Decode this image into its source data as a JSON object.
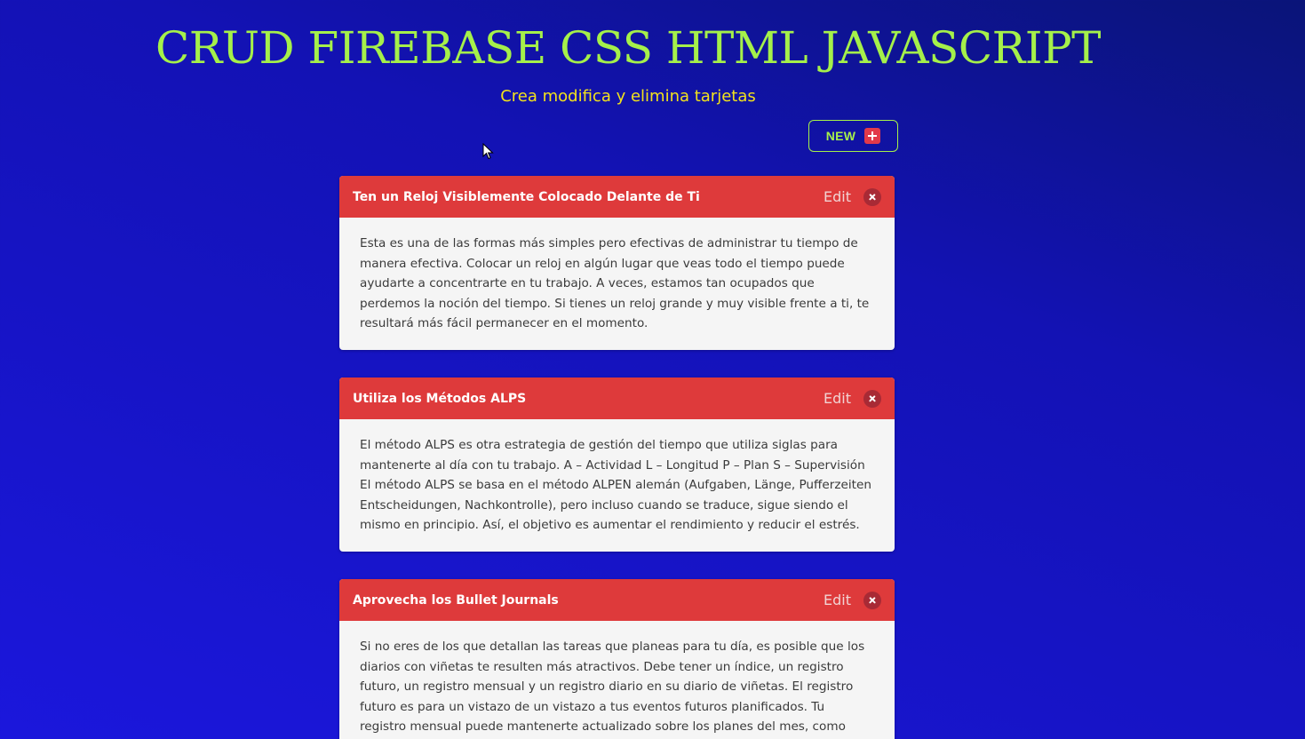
{
  "header": {
    "title": "CRUD FIREBASE CSS HTML JAVASCRIPT",
    "subtitle": "Crea modifica y elimina tarjetas"
  },
  "toolbar": {
    "new_label": "NEW",
    "new_icon": "plus-icon"
  },
  "colors": {
    "background": "#1a16d2",
    "title": "#a5f04a",
    "subtitle": "#f2e21c",
    "card_header": "#de3a3b",
    "card_body": "#f5f5f5"
  },
  "cards": [
    {
      "title": "Ten un Reloj Visiblemente Colocado Delante de Ti",
      "edit_label": "Edit",
      "body": "Esta es una de las formas más simples pero efectivas de administrar tu tiempo de manera efectiva. Colocar un reloj en algún lugar que veas todo el tiempo puede ayudarte a concentrarte en tu trabajo. A veces, estamos tan ocupados que perdemos la noción del tiempo. Si tienes un reloj grande y muy visible frente a ti, te resultará más fácil permanecer en el momento."
    },
    {
      "title": "Utiliza los Métodos ALPS",
      "edit_label": "Edit",
      "body": "El método ALPS es otra estrategia de gestión del tiempo que utiliza siglas para mantenerte al día con tu trabajo. A – Actividad L – Longitud P – Plan S – Supervisión El método ALPS se basa en el método ALPEN alemán (Aufgaben, Länge, Pufferzeiten Entscheidungen, Nachkontrolle), pero incluso cuando se traduce, sigue siendo el mismo en principio. Así, el objetivo es aumentar el rendimiento y reducir el estrés."
    },
    {
      "title": "Aprovecha los Bullet Journals",
      "edit_label": "Edit",
      "body": "Si no eres de los que detallan las tareas que planeas para tu día, es posible que los diarios con viñetas te resulten más atractivos. Debe tener un índice, un registro futuro, un registro mensual y un registro diario en su diario de viñetas. El registro futuro es para un vistazo de un vistazo a tus eventos futuros planificados. Tu registro mensual puede mantenerte actualizado sobre los planes del mes, como cumpleaños y días"
    }
  ]
}
